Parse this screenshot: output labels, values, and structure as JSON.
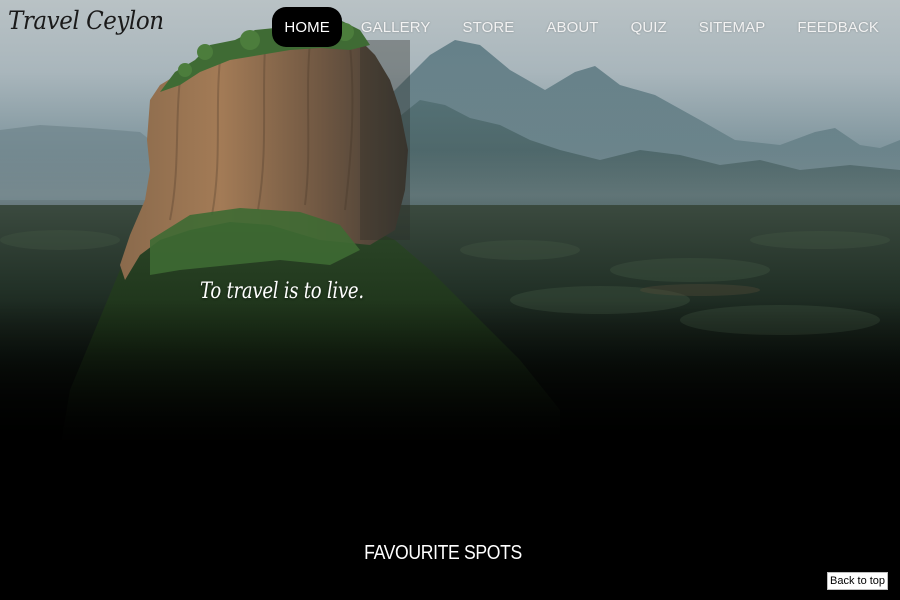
{
  "site": {
    "logo_text": "Travel Ceylon"
  },
  "nav": {
    "items": [
      {
        "label": "HOME",
        "active": true
      },
      {
        "label": "GALLERY",
        "active": false
      },
      {
        "label": "STORE",
        "active": false
      },
      {
        "label": "ABOUT",
        "active": false
      },
      {
        "label": "QUIZ",
        "active": false
      },
      {
        "label": "SITEMAP",
        "active": false
      },
      {
        "label": "FEEDBACK",
        "active": false
      }
    ]
  },
  "hero": {
    "tagline": "To travel is to live."
  },
  "sections": {
    "favourite_title": "FAVOURITE SPOTS"
  },
  "back_to_top": {
    "label": "Back to top"
  },
  "colors": {
    "page_background": "#000000",
    "active_nav_bg": "#000000",
    "nav_text": "#f2f2f2",
    "logo_text": "#1a1a1a"
  }
}
